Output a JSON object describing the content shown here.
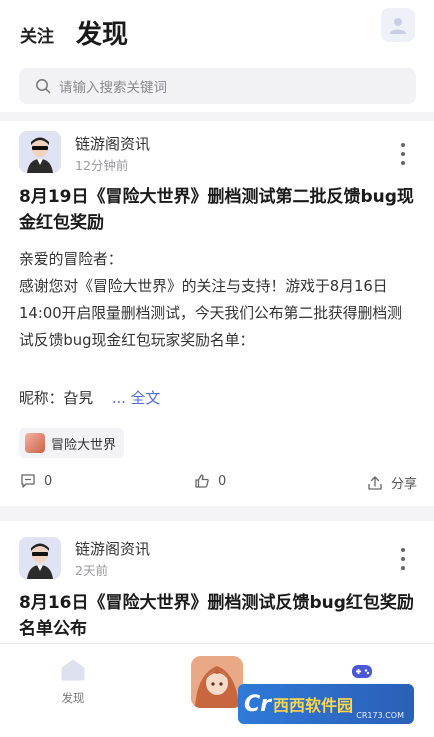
{
  "header": {
    "tab_follow": "关注",
    "tab_discover": "发现",
    "profile_icon": "user-icon"
  },
  "search": {
    "placeholder": "请输入搜索关键词",
    "icon": "search-icon"
  },
  "posts": [
    {
      "author": "链游阁资讯",
      "time": "12分钟前",
      "title": "8月19日《冒险大世界》删档测试第二批反馈bug现金红包奖励",
      "body": [
        "亲爱的冒险者：",
        "感谢您对《冒险大世界》的关注与支持！游戏于8月16日14:00开启限量删档测试，今天我们公布第二批获得删档测试反馈bug现金红包玩家奖励名单："
      ],
      "nick_line": "昵称：旮旯",
      "more_text": "... 全文",
      "game_tag": "冒险大世界",
      "comments": "0",
      "likes": "0",
      "share": "分享"
    },
    {
      "author": "链游阁资讯",
      "time": "2天前",
      "title": "8月16日《冒险大世界》删档测试反馈bug红包奖励名单公布"
    }
  ],
  "bottom_nav": {
    "discover_label": "发现",
    "watermark_logo": "Cr",
    "watermark_text": "西西软件园",
    "watermark_sub": "CR173.COM"
  },
  "colors": {
    "accent": "#4f6fd4",
    "background": "#f4f4f6",
    "game_icon": "#4a57d8"
  }
}
